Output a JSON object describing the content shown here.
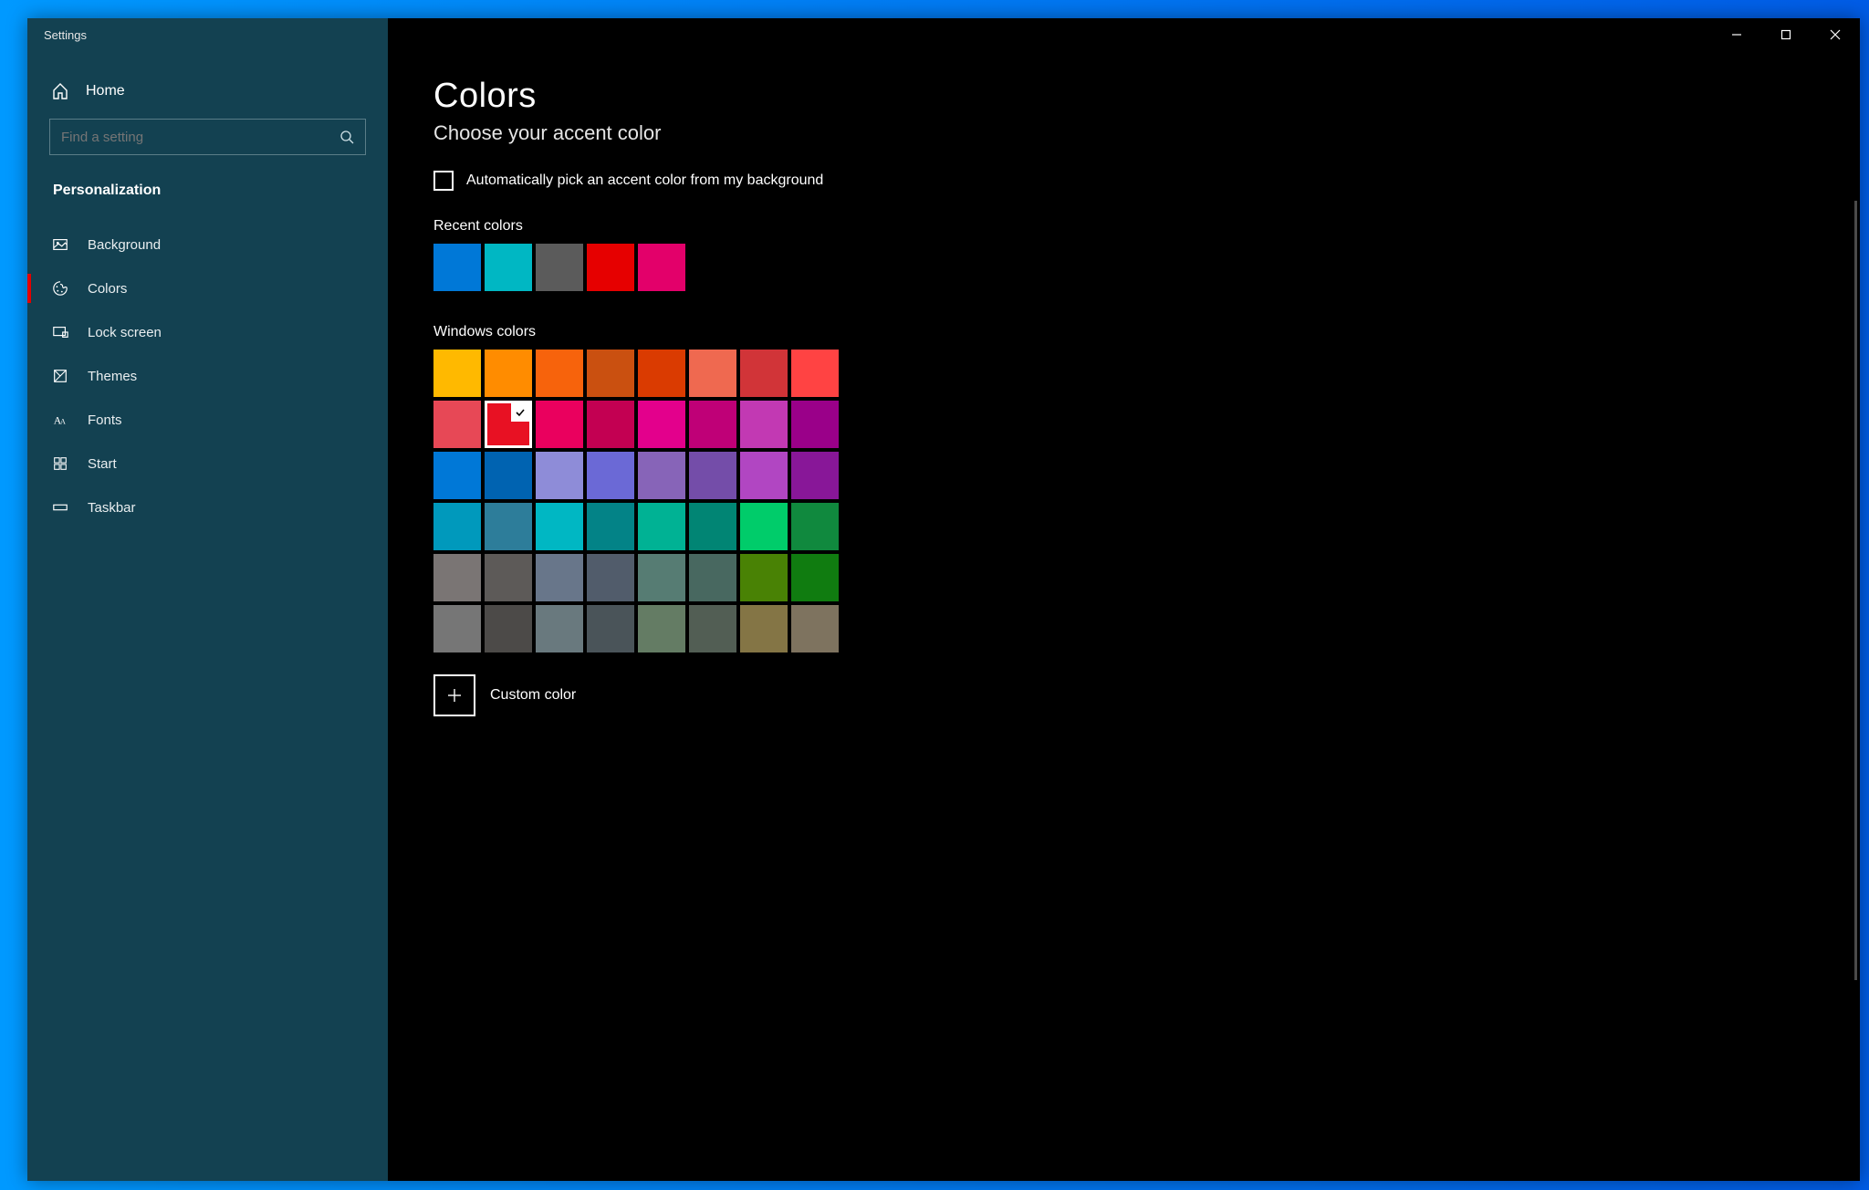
{
  "window": {
    "title": "Settings"
  },
  "sidebar": {
    "home": "Home",
    "search_placeholder": "Find a setting",
    "category": "Personalization",
    "items": [
      {
        "label": "Background",
        "icon": "image"
      },
      {
        "label": "Colors",
        "icon": "palette",
        "active": true
      },
      {
        "label": "Lock screen",
        "icon": "lock-screen"
      },
      {
        "label": "Themes",
        "icon": "themes"
      },
      {
        "label": "Fonts",
        "icon": "fonts"
      },
      {
        "label": "Start",
        "icon": "start"
      },
      {
        "label": "Taskbar",
        "icon": "taskbar"
      }
    ]
  },
  "main": {
    "heading": "Colors",
    "subheading": "Choose your accent color",
    "auto_accent_label": "Automatically pick an accent color from my background",
    "recent_label": "Recent colors",
    "recent_colors": [
      "#0078d7",
      "#00b7c3",
      "#5b5b5b",
      "#e60000",
      "#e3006a"
    ],
    "windows_label": "Windows colors",
    "windows_colors": [
      "#ffb900",
      "#ff8c00",
      "#f7630c",
      "#ca5010",
      "#da3b01",
      "#ef6950",
      "#d13438",
      "#ff4343",
      "#e74856",
      "#e81123",
      "#ea005e",
      "#c30052",
      "#e3008c",
      "#bf0077",
      "#c239b3",
      "#9a0089",
      "#0078d7",
      "#0063b1",
      "#8e8cd8",
      "#6b69d6",
      "#8764b8",
      "#744da9",
      "#b146c2",
      "#881798",
      "#0099bc",
      "#2d7d9a",
      "#00b7c3",
      "#038387",
      "#00b294",
      "#018574",
      "#00cc6a",
      "#10893e",
      "#7a7574",
      "#5d5a58",
      "#68768a",
      "#515c6b",
      "#567c73",
      "#486860",
      "#498205",
      "#107c10",
      "#767676",
      "#4c4a48",
      "#69797e",
      "#4a5459",
      "#647c64",
      "#525e54",
      "#847545",
      "#7e735f"
    ],
    "selected_index": 9,
    "custom_label": "Custom color"
  }
}
